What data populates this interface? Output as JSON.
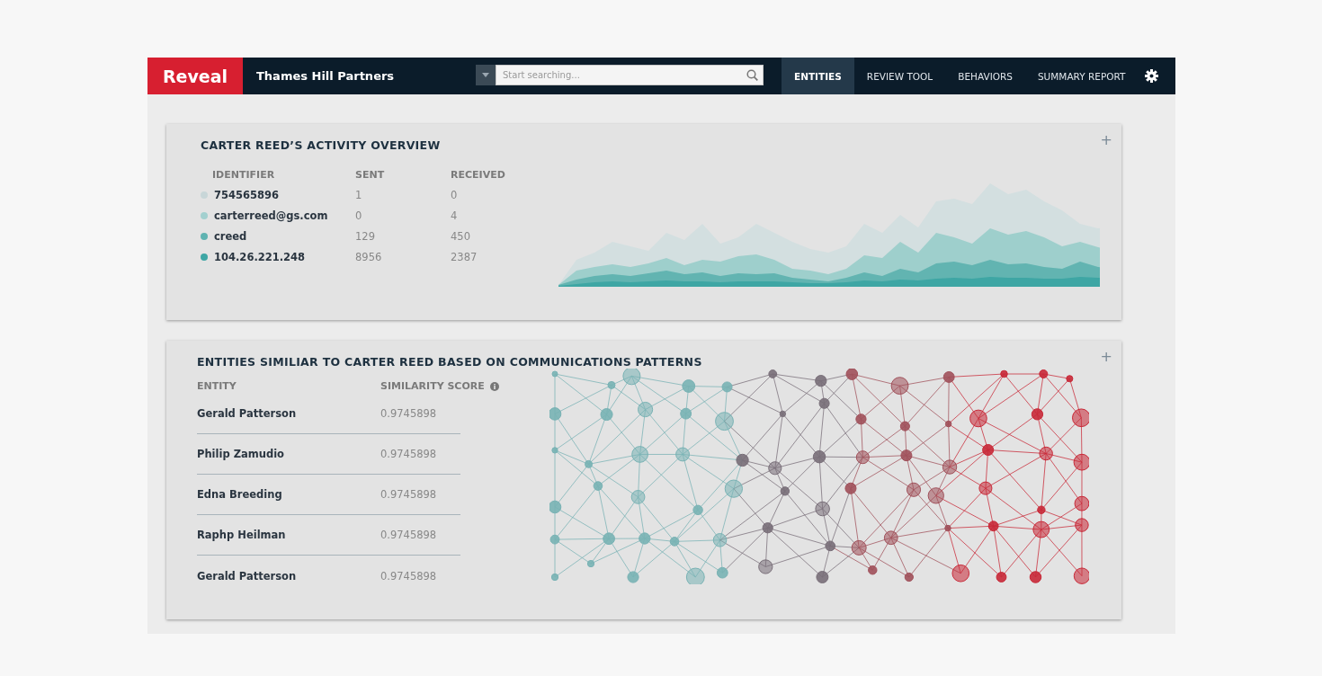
{
  "brand": "Reveal",
  "organization": "Thames Hill Partners",
  "search": {
    "placeholder": "Start searching..."
  },
  "nav": [
    {
      "label": "ENTITIES",
      "selected": true
    },
    {
      "label": "REVIEW TOOL",
      "selected": false
    },
    {
      "label": "BEHAVIORS",
      "selected": false
    },
    {
      "label": "SUMMARY REPORT",
      "selected": false
    }
  ],
  "activity": {
    "title": "CARTER REED’S ACTIVITY OVERVIEW",
    "expand": "+",
    "columns": [
      "IDENTIFIER",
      "SENT",
      "RECEIVED"
    ],
    "rows": [
      {
        "identifier": "754565896",
        "sent": "1",
        "received": "0",
        "color": "#c8d6d8"
      },
      {
        "identifier": "carterreed@gs.com",
        "sent": "0",
        "received": "4",
        "color": "#a3d0cf"
      },
      {
        "identifier": "creed",
        "sent": "129",
        "received": "450",
        "color": "#5fb3b1"
      },
      {
        "identifier": "104.26.221.248",
        "sent": "8956",
        "received": "2387",
        "color": "#3ea6a4"
      }
    ]
  },
  "similar": {
    "title": "ENTITIES SIMILIAR TO CARTER REED BASED ON COMMUNICATIONS PATTERNS",
    "expand": "+",
    "columns": [
      "ENTITY",
      "SIMILARITY SCORE"
    ],
    "rows": [
      {
        "entity": "Gerald Patterson",
        "score": "0.9745898"
      },
      {
        "entity": "Philip Zamudio",
        "score": "0.9745898"
      },
      {
        "entity": "Edna Breeding",
        "score": "0.9745898"
      },
      {
        "entity": "Raphp Heilman",
        "score": "0.9745898"
      },
      {
        "entity": "Gerald Patterson",
        "score": "0.9745898"
      }
    ]
  }
}
